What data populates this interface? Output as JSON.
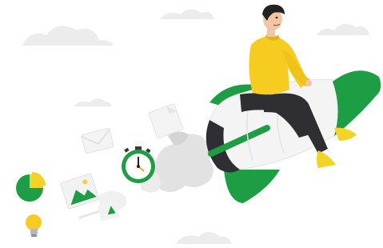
{
  "illustration": {
    "elements": [
      "cloud-icon",
      "pie-chart-icon",
      "image-icon",
      "lightbulb-icon",
      "envelope-icon",
      "stopwatch-icon",
      "document-icon",
      "rocket-icon",
      "rider-figure"
    ]
  },
  "colors": {
    "brand_green": "#1e9e44",
    "light_green": "#2fbf58",
    "shirt_yellow": "#f5cc1f",
    "shoe_yellow": "#f3d325",
    "cloud_gray": "#ececec",
    "smoke_gray": "#dedede",
    "pants_dark": "#2f2f33",
    "hair_dark": "#222222",
    "skin": "#f1c7a3"
  }
}
